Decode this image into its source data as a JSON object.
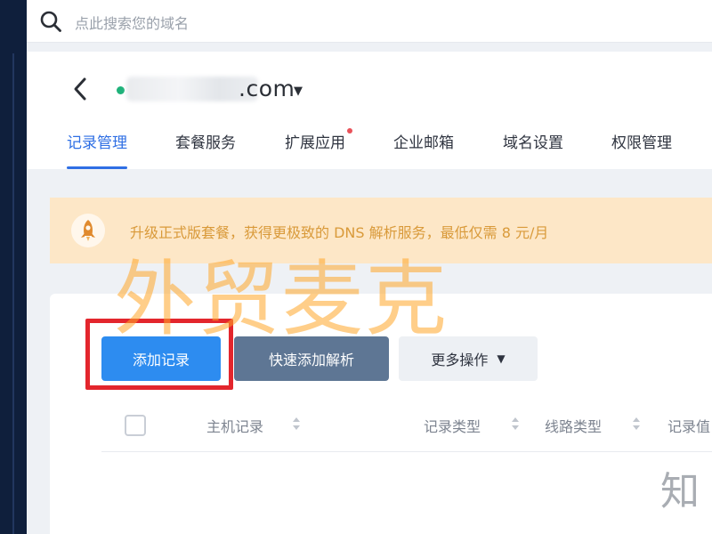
{
  "search": {
    "placeholder": "点此搜索您的域名"
  },
  "header": {
    "domain_suffix": ".com",
    "status_color": "#1fb27a"
  },
  "tabs": [
    {
      "label": "记录管理",
      "active": true
    },
    {
      "label": "套餐服务",
      "active": false
    },
    {
      "label": "扩展应用",
      "active": false,
      "badge": true
    },
    {
      "label": "企业邮箱",
      "active": false
    },
    {
      "label": "域名设置",
      "active": false
    },
    {
      "label": "权限管理",
      "active": false
    }
  ],
  "notice": {
    "text": "升级正式版套餐，获得更极致的 DNS 解析服务，最低仅需 8 元/月",
    "icon": "rocket-icon"
  },
  "toolbar": {
    "add_record": "添加记录",
    "quick_add": "快速添加解析",
    "more_actions": "更多操作"
  },
  "table": {
    "columns": [
      "主机记录",
      "记录类型",
      "线路类型",
      "记录值"
    ]
  },
  "watermark": {
    "text": "外贸麦克"
  },
  "corner_mark": {
    "text": "知"
  },
  "colors": {
    "accent": "#2f6fe4",
    "primary_button": "#2d8cf0",
    "secondary_button": "#5e7694",
    "notice_bg": "#fde7c7",
    "highlight": "#e3262d"
  }
}
